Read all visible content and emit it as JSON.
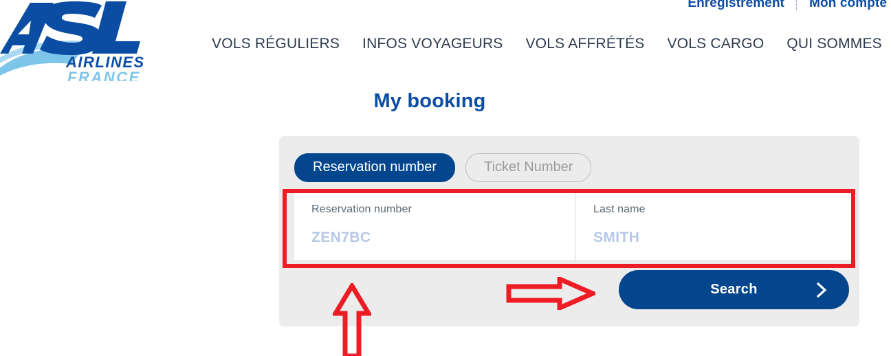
{
  "brand": {
    "logo_primary": "ASL",
    "logo_sub1": "AIRLINES",
    "logo_sub2": "FRANCE",
    "navy": "#0b4da2",
    "light_blue": "#7ec5ea"
  },
  "header": {
    "utility_links": [
      {
        "label": "Enregistrement"
      },
      {
        "label": "Mon compte"
      }
    ],
    "nav_items": [
      {
        "label": "VOLS RÉGULIERS"
      },
      {
        "label": "INFOS VOYAGEURS"
      },
      {
        "label": "VOLS AFFRÉTÉS"
      },
      {
        "label": "VOLS CARGO"
      },
      {
        "label": "QUI SOMMES"
      }
    ]
  },
  "page": {
    "title": "My booking"
  },
  "booking_panel": {
    "tabs": [
      {
        "label": "Reservation number",
        "active": true
      },
      {
        "label": "Ticket Number",
        "active": false
      }
    ],
    "fields": [
      {
        "label": "Reservation number",
        "placeholder": "ZEN7BC",
        "value": "ZEN7BC"
      },
      {
        "label": "Last name",
        "placeholder": "SMITH",
        "value": "SMITH"
      }
    ],
    "search_button": {
      "label": "Search",
      "icon": "chevron-right-icon"
    }
  },
  "annotations": {
    "color": "#ee1c24",
    "highlight_rect": "fields-highlight",
    "arrow_up": "arrow-up-annotation",
    "arrow_right": "arrow-right-annotation"
  }
}
